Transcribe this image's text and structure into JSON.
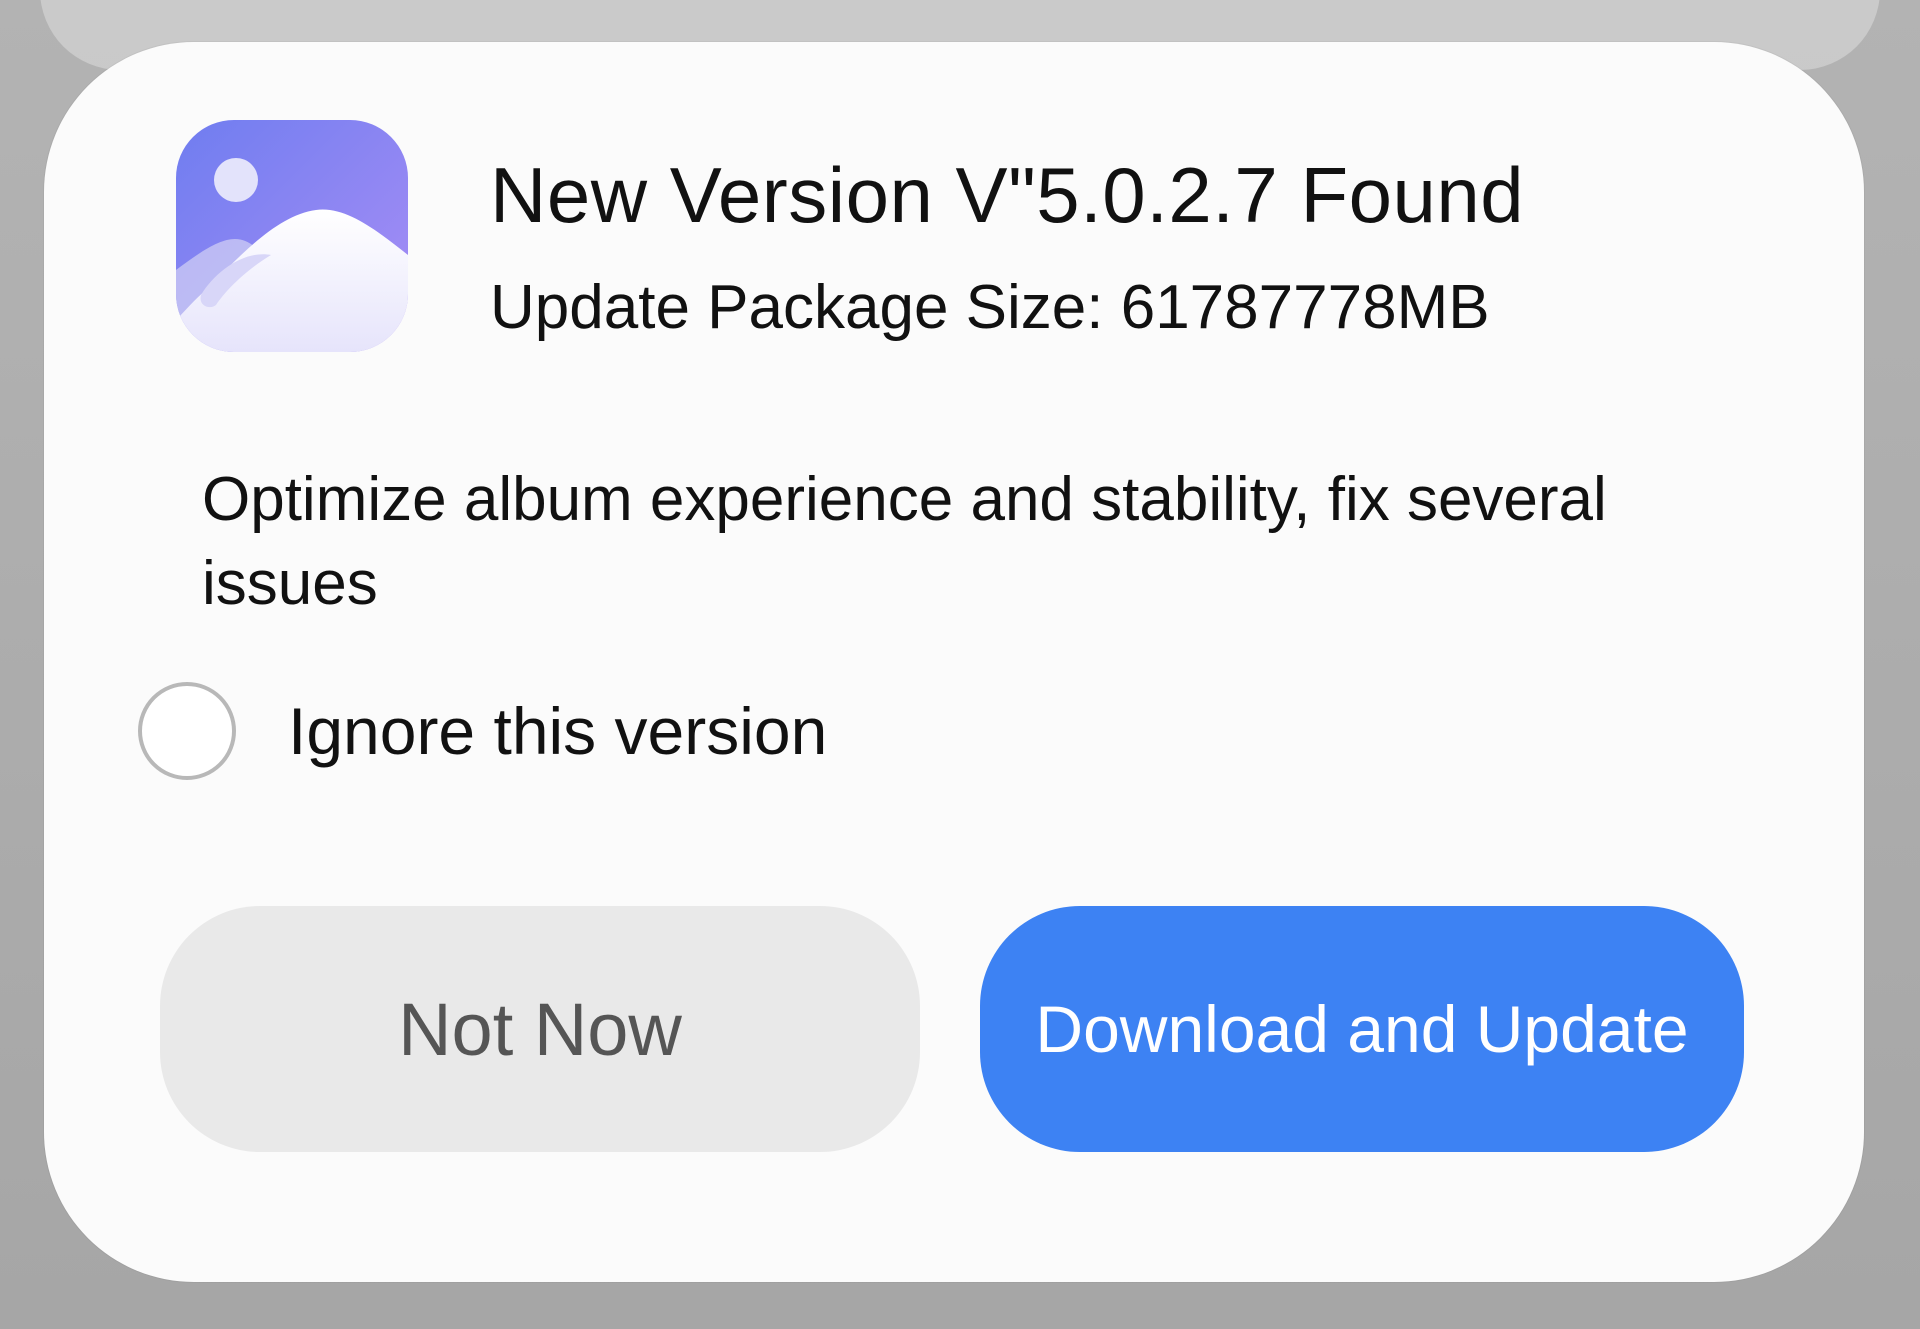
{
  "dialog": {
    "app_icon": "photo-gallery-icon",
    "title": "New Version V\"5.0.2.7 Found",
    "package_size": "Update Package Size: 61787778MB",
    "description": "Optimize album experience and stability, fix several issues",
    "ignore_option": {
      "label": "Ignore this version",
      "checked": false
    },
    "buttons": {
      "not_now": "Not Now",
      "download_update": "Download and Update"
    }
  },
  "colors": {
    "primary_button": "#3d82f3",
    "secondary_button": "#e9e9e9",
    "icon_gradient_start": "#6f7df0",
    "icon_gradient_end": "#a98ef5"
  }
}
